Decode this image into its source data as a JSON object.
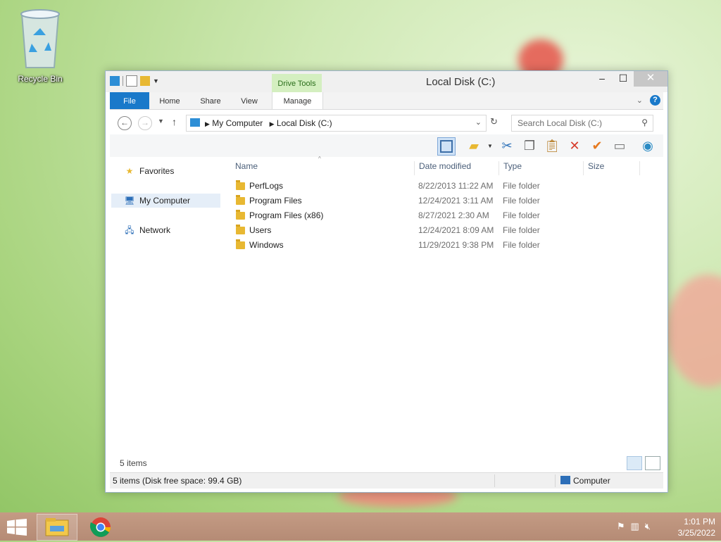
{
  "desktop": {
    "recycle_bin": "Recycle Bin"
  },
  "window": {
    "title": "Local Disk (C:)",
    "contextual_group": "Drive Tools",
    "tabs": [
      "File",
      "Home",
      "Share",
      "View",
      "Manage"
    ],
    "address": {
      "crumb1": "My Computer",
      "crumb2": "Local Disk (C:)"
    },
    "search_placeholder": "Search Local Disk (C:)",
    "nav": {
      "favorites": "Favorites",
      "my_computer": "My Computer",
      "network": "Network"
    },
    "columns": {
      "name": "Name",
      "date": "Date modified",
      "type": "Type",
      "size": "Size"
    },
    "files": [
      {
        "name": "PerfLogs",
        "date": "8/22/2013 11:22 AM",
        "type": "File folder"
      },
      {
        "name": "Program Files",
        "date": "12/24/2021 3:11 AM",
        "type": "File folder"
      },
      {
        "name": "Program Files (x86)",
        "date": "8/27/2021 2:30 AM",
        "type": "File folder"
      },
      {
        "name": "Users",
        "date": "12/24/2021 8:09 AM",
        "type": "File folder"
      },
      {
        "name": "Windows",
        "date": "11/29/2021 9:38 PM",
        "type": "File folder"
      }
    ],
    "items_count": "5 items",
    "status_left": "5 items (Disk free space: 99.4 GB)",
    "status_right": "Computer"
  },
  "taskbar": {
    "time": "1:01 PM",
    "date": "3/25/2022"
  },
  "colors": {
    "accent": "#1979ca",
    "drive_tools": "#d4efc0"
  }
}
